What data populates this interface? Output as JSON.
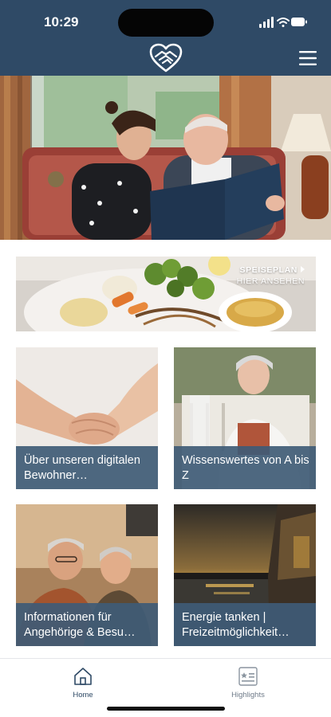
{
  "status_bar": {
    "time": "10:29"
  },
  "header": {
    "logo": "heart-hands-logo",
    "menu_icon": "hamburger-icon"
  },
  "hero": {
    "image": "caregiver-and-senior-reading-photo"
  },
  "banner": {
    "title": "SPEISEPLAN",
    "subtitle": "HIER ANSEHEN",
    "image": "food-plate-photo"
  },
  "tiles": [
    {
      "label": "Über unseren digitalen Bewohner…",
      "image": "holding-hands-photo"
    },
    {
      "label": "Wissenswertes von A bis Z",
      "image": "senior-woman-reading-photo"
    },
    {
      "label": "Informationen für Angehörige & Besu…",
      "image": "senior-couple-photo"
    },
    {
      "label": "Energie tanken | Freizeitmöglichkeit…",
      "image": "sunset-lake-photo"
    }
  ],
  "tabbar": {
    "tabs": [
      {
        "label": "Home",
        "icon": "house-icon",
        "active": true
      },
      {
        "label": "Highlights",
        "icon": "star-list-icon",
        "active": false
      }
    ]
  },
  "colors": {
    "primary": "#2f4a66",
    "tile_caption": "#3f5b76",
    "background": "#ffffff"
  }
}
